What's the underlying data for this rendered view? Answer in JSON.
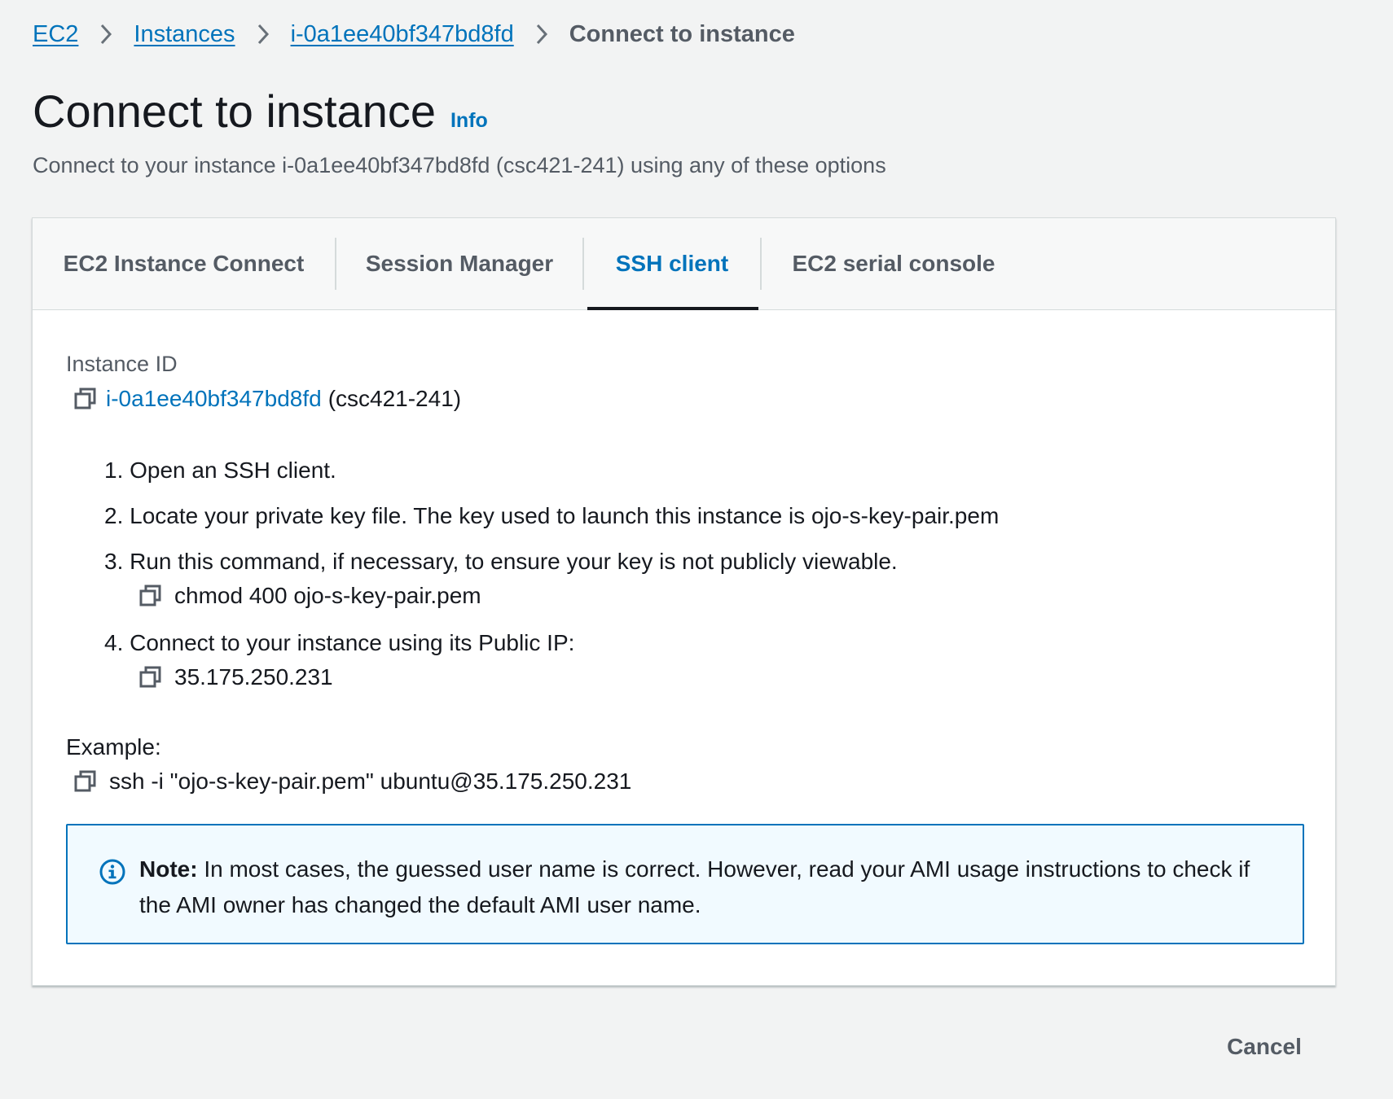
{
  "breadcrumb": {
    "items": [
      {
        "label": "EC2"
      },
      {
        "label": "Instances"
      },
      {
        "label": "i-0a1ee40bf347bd8fd"
      }
    ],
    "current": "Connect to instance"
  },
  "header": {
    "title": "Connect to instance",
    "info_label": "Info",
    "subtitle": "Connect to your instance i-0a1ee40bf347bd8fd (csc421-241) using any of these options"
  },
  "tabs": [
    {
      "label": "EC2 Instance Connect",
      "active": false
    },
    {
      "label": "Session Manager",
      "active": false
    },
    {
      "label": "SSH client",
      "active": true
    },
    {
      "label": "EC2 serial console",
      "active": false
    }
  ],
  "ssh": {
    "instance_id_label": "Instance ID",
    "instance_id": "i-0a1ee40bf347bd8fd",
    "instance_name": "(csc421-241)",
    "steps": [
      "1. Open an SSH client.",
      "2. Locate your private key file. The key used to launch this instance is ojo-s-key-pair.pem",
      "3. Run this command, if necessary, to ensure your key is not publicly viewable.",
      "4. Connect to your instance using its Public IP:"
    ],
    "chmod_command": "chmod 400 ojo-s-key-pair.pem",
    "public_ip": "35.175.250.231",
    "example_label": "Example:",
    "example_command": "ssh -i \"ojo-s-key-pair.pem\" ubuntu@35.175.250.231"
  },
  "alert": {
    "note_label": "Note:",
    "text": " In most cases, the guessed user name is correct. However, read your AMI usage instructions to check if the AMI owner has changed the default AMI user name."
  },
  "footer": {
    "cancel_label": "Cancel"
  },
  "colors": {
    "link": "#0073bb",
    "text_primary": "#16191f",
    "text_secondary": "#545b64",
    "page_background": "#f2f3f3",
    "alert_background": "#f1faff",
    "border": "#d5dbdb"
  },
  "icons": {
    "breadcrumb_separator": "chevron-right-icon",
    "copy": "copy-icon",
    "alert": "info-circle-icon"
  }
}
